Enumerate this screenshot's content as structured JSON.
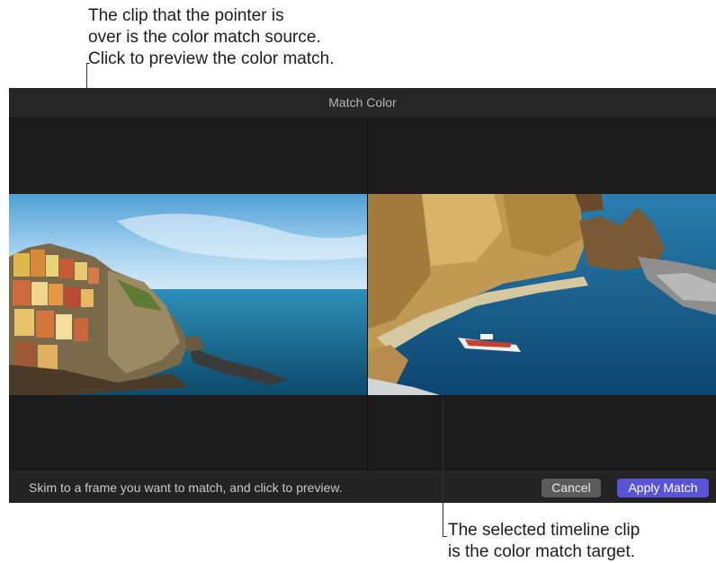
{
  "annotations": {
    "top": [
      "The clip that the pointer is",
      "over is the color match source.",
      "Click to preview the color match."
    ],
    "bottom": [
      "The selected timeline clip",
      "is the color match target."
    ]
  },
  "window": {
    "title": "Match Color",
    "hint": "Skim to a frame you want to match, and click to preview.",
    "cancel_label": "Cancel",
    "apply_label": "Apply Match"
  },
  "colors": {
    "accent": "#5a53d6",
    "window_bg": "#1b1b1b",
    "cancel_bg": "#5b5b5b"
  }
}
